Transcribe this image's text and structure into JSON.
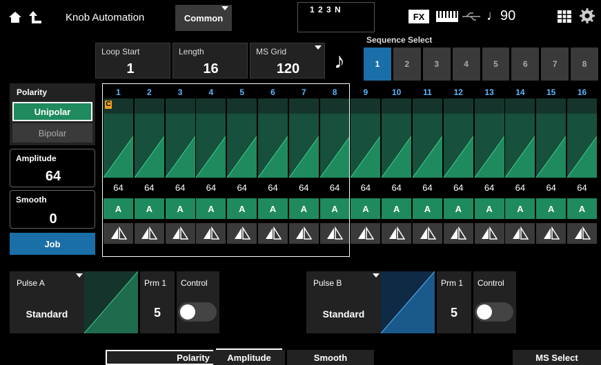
{
  "header": {
    "title": "Knob Automation",
    "part_select": "Common",
    "part_indicator": "1 2 3 N",
    "fx_label": "FX",
    "tempo_symbol": "♩",
    "tempo_value": "90"
  },
  "params": {
    "loop_start_label": "Loop Start",
    "loop_start_value": "1",
    "length_label": "Length",
    "length_value": "16",
    "ms_grid_label": "MS Grid",
    "ms_grid_value": "120",
    "note_symbol": "♪"
  },
  "sequence_select": {
    "label": "Sequence Select",
    "items": [
      "1",
      "2",
      "3",
      "4",
      "5",
      "6",
      "7",
      "8"
    ],
    "selected": "1"
  },
  "polarity": {
    "label": "Polarity",
    "unipolar": "Unipolar",
    "bipolar": "Bipolar"
  },
  "amplitude": {
    "label": "Amplitude",
    "value": "64"
  },
  "smooth": {
    "label": "Smooth",
    "value": "0"
  },
  "job_label": "Job",
  "steps": {
    "numbers": [
      "1",
      "2",
      "3",
      "4",
      "5",
      "6",
      "7",
      "8",
      "9",
      "10",
      "11",
      "12",
      "13",
      "14",
      "15",
      "16"
    ],
    "values": [
      "64",
      "64",
      "64",
      "64",
      "64",
      "64",
      "64",
      "64",
      "64",
      "64",
      "64",
      "64",
      "64",
      "64",
      "64",
      "64"
    ],
    "modes": [
      "A",
      "A",
      "A",
      "A",
      "A",
      "A",
      "A",
      "A",
      "A",
      "A",
      "A",
      "A",
      "A",
      "A",
      "A",
      "A"
    ],
    "start_marker": "C"
  },
  "pulse_a": {
    "label": "Pulse A",
    "value": "Standard",
    "prm_label": "Prm 1",
    "prm_value": "5",
    "control_label": "Control"
  },
  "pulse_b": {
    "label": "Pulse B",
    "value": "Standard",
    "prm_label": "Prm 1",
    "prm_value": "5",
    "control_label": "Control"
  },
  "tabs": {
    "polarity": "Polarity",
    "amplitude": "Amplitude",
    "smooth": "Smooth",
    "ms_select": "MS Select"
  }
}
